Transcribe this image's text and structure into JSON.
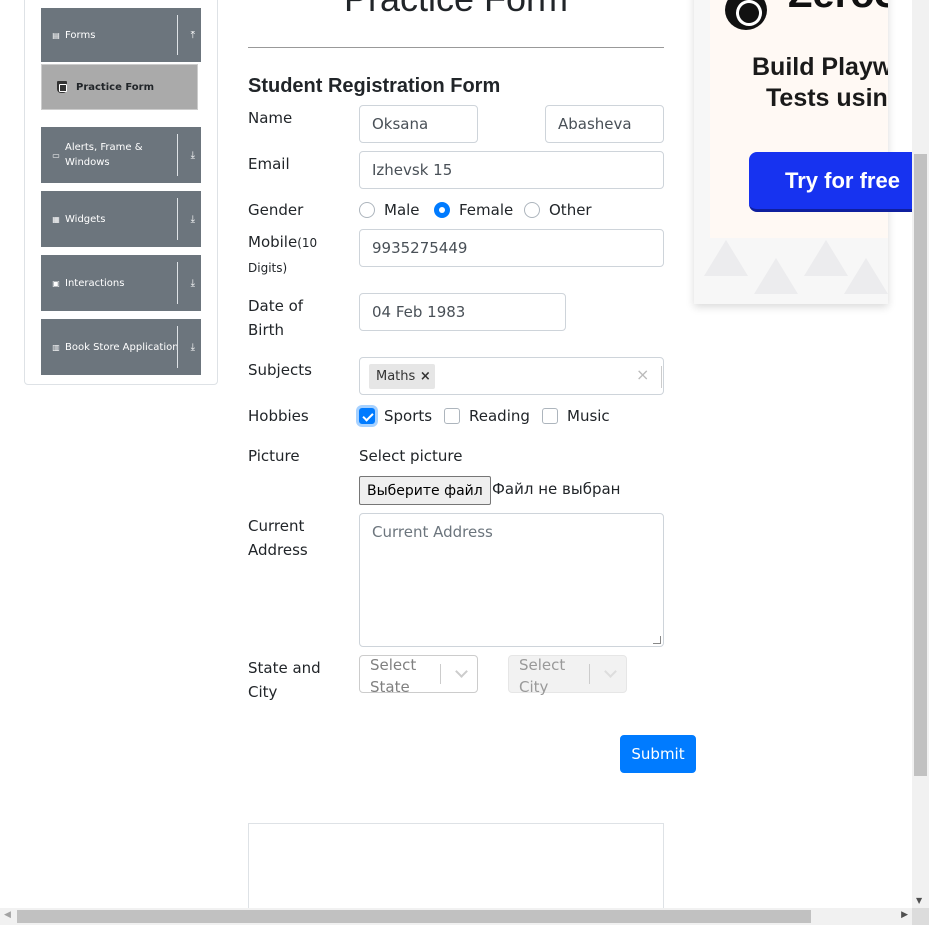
{
  "sidebar": {
    "groups": [
      {
        "label": "Forms",
        "icon": "form-icon",
        "arrow": "⤒"
      },
      {
        "label": "Alerts, Frame & Windows",
        "icon": "window-icon",
        "arrow": "⤓"
      },
      {
        "label": "Widgets",
        "icon": "widgets-icon",
        "arrow": "⤓"
      },
      {
        "label": "Interactions",
        "icon": "interactions-icon",
        "arrow": "⤓"
      },
      {
        "label": "Book Store Application",
        "icon": "book-icon",
        "arrow": "⤓"
      }
    ],
    "active_item": {
      "label": "Practice Form",
      "icon": "html5-icon"
    }
  },
  "form": {
    "page_title": "Practice Form",
    "heading": "Student Registration Form",
    "name_label": "Name",
    "first_name": "Oksana",
    "last_name": "Abasheva",
    "email_label": "Email",
    "email_value": "Izhevsk 15",
    "gender_label": "Gender",
    "gender_options": [
      "Male",
      "Female",
      "Other"
    ],
    "gender_selected": "Female",
    "mobile_label": "Mobile",
    "mobile_hint": "(10 Digits)",
    "mobile_value": "9935275449",
    "dob_label_1": "Date of",
    "dob_label_2": "Birth",
    "dob_value": "04 Feb 1983",
    "subjects_label": "Subjects",
    "subjects_selected": [
      "Maths"
    ],
    "chip_remove": "×",
    "clear_all": "×",
    "hobbies_label": "Hobbies",
    "hobbies_options": [
      "Sports",
      "Reading",
      "Music"
    ],
    "hobbies_checked": [
      "Sports"
    ],
    "picture_label": "Picture",
    "picture_select_text": "Select picture",
    "file_button": "Выберите файл",
    "file_status": "Файл не выбран",
    "address_label_1": "Current",
    "address_label_2": "Address",
    "address_placeholder": "Current Address",
    "state_city_label_1": "State and",
    "state_city_label_2": "City",
    "state_placeholder": "Select State",
    "city_placeholder": "Select City",
    "submit": "Submit"
  },
  "ad": {
    "brand": "ZeroS",
    "headline_1": "Build Playwr",
    "headline_2": "Tests using",
    "cta": "Try for free"
  },
  "scrollbars": {
    "down_arrow": "▼",
    "left_arrow": "◀",
    "right_arrow": "▶"
  },
  "colors": {
    "sidebar_header": "#6c757d",
    "active_item": "#aaaaaa",
    "primary": "#007bff",
    "ad_cta": "#1733f0"
  }
}
